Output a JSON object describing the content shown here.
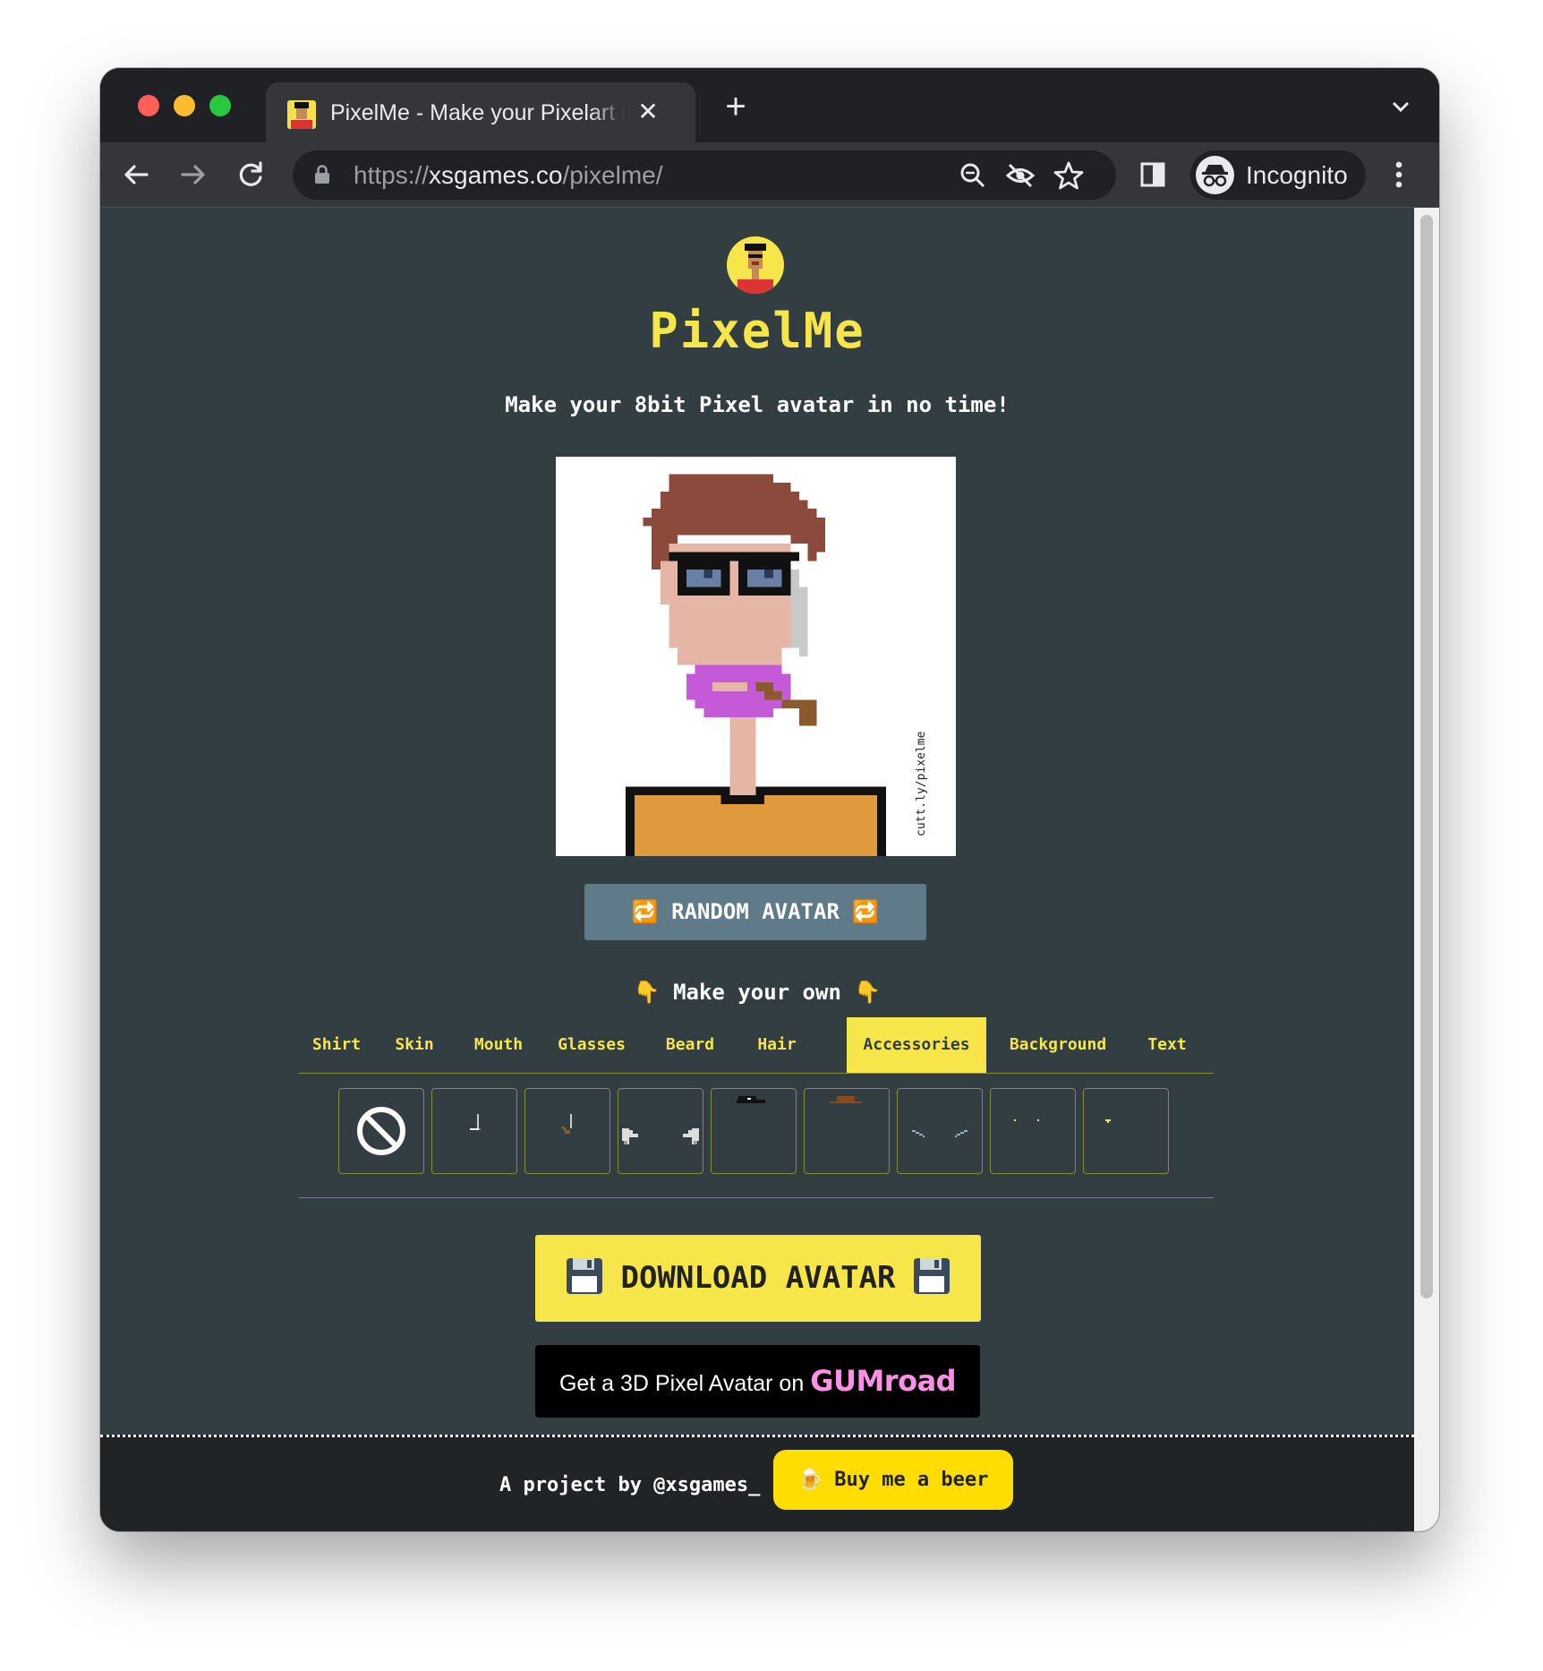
{
  "browser": {
    "tab_title": "PixelMe - Make your Pixelart avatar",
    "tab_close": "✕",
    "new_tab": "+",
    "tab_menu": "⌄",
    "url_scheme": "https://",
    "url_host": "xsgames.co",
    "url_path": "/pixelme/",
    "profile_label": "Incognito",
    "icons": [
      "back-arrow-icon",
      "forward-arrow-icon",
      "reload-icon",
      "lock-icon",
      "zoom-icon",
      "tracking-protection-icon",
      "bookmark-star-icon",
      "side-panel-icon",
      "incognito-icon",
      "more-menu-icon"
    ]
  },
  "page": {
    "title": "PixelMe",
    "tagline": "Make your 8bit Pixel avatar in no time!",
    "watermark": "cutt.ly/pixelme",
    "random_button": "🔁 RANDOM AVATAR 🔁",
    "make_own": "👇 Make your own 👇",
    "categories": [
      "Shirt",
      "Skin",
      "Mouth",
      "Glasses",
      "Beard",
      "Hair",
      "Accessories",
      "Background",
      "Text"
    ],
    "active_category": "Accessories",
    "accessory_items": [
      "none",
      "cigarette",
      "pipe",
      "headphones",
      "black cap",
      "brown hat",
      "earrings long",
      "earrings studs",
      "ear stud single"
    ],
    "download_button": "DOWNLOAD AVATAR",
    "gumroad_text": "Get a 3D Pixel Avatar on",
    "gumroad_brand": "GUMroad",
    "footer_text": "A project by @xsgames_",
    "beer_button": "🍺 Buy me a beer"
  },
  "colors": {
    "page_bg": "#333e43",
    "accent_yellow": "#f6e64a",
    "random_btn": "#5f7a88",
    "gumroad_pink": "#ff90e8",
    "avatar_hair": "#8b4a3c",
    "avatar_skin": "#e5b5a6",
    "avatar_beard": "#c45ad7",
    "avatar_shirt": "#de9a3d"
  }
}
